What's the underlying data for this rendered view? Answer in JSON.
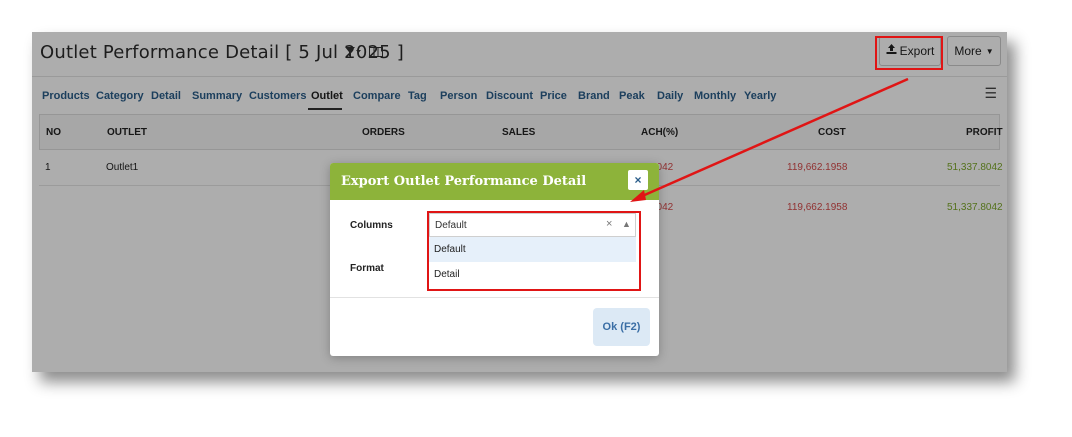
{
  "header": {
    "title": "Outlet Performance Detail [ 5 Jul 2025 ]",
    "filter_icon": "filter-dropdown-icon",
    "columns_icon": "columns-icon",
    "export_label": "Export",
    "more_label": "More"
  },
  "tabs": [
    "Products",
    "Category",
    "Detail",
    "Summary",
    "Customers",
    "Outlet",
    "Compare",
    "Tag",
    "Person",
    "Discount",
    "Price",
    "Brand",
    "Peak",
    "Daily",
    "Monthly",
    "Yearly"
  ],
  "active_tab": "Outlet",
  "table": {
    "columns": [
      "NO",
      "OUTLET",
      "ORDERS",
      "SALES",
      "ACH(%)",
      "COST",
      "PROFIT"
    ],
    "rows": [
      {
        "no": "1",
        "outlet": "Outlet1",
        "ach": "3042",
        "cost": "119,662.1958",
        "profit": "51,337.8042"
      }
    ],
    "total": {
      "ach": "3042",
      "cost": "119,662.1958",
      "profit": "51,337.8042"
    }
  },
  "modal": {
    "title": "Export Outlet Performance Detail",
    "columns_label": "Columns",
    "format_label": "Format",
    "select_value": "Default",
    "clear_icon": "×",
    "options": [
      "Default",
      "Detail"
    ],
    "ok_label": "Ok (F2)"
  },
  "colors": {
    "accent": "#8db33a",
    "link": "#2a5d8a",
    "negative": "#d64a4a",
    "positive": "#7da82a",
    "highlight": "#e01515"
  }
}
